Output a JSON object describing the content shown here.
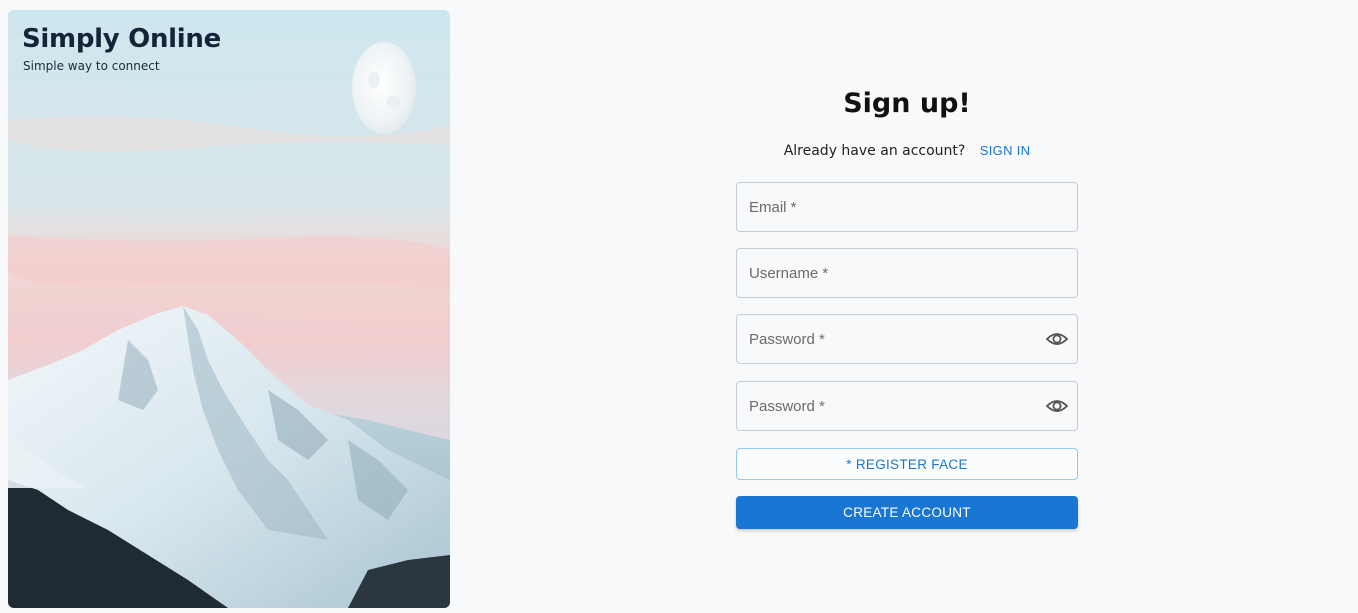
{
  "brand": {
    "title": "Simply Online",
    "tagline": "Simple way to connect"
  },
  "form": {
    "heading": "Sign up!",
    "signin_prompt": "Already have an account?",
    "signin_link": "SIGN IN",
    "fields": {
      "email": {
        "placeholder": "Email *",
        "value": ""
      },
      "username": {
        "placeholder": "Username *",
        "value": ""
      },
      "password": {
        "placeholder": "Password *",
        "value": ""
      },
      "password_confirm": {
        "placeholder": "Password *",
        "value": ""
      }
    },
    "register_face_label": "* REGISTER FACE",
    "create_account_label": "CREATE ACCOUNT"
  },
  "icons": {
    "visibility_toggle": "eye-icon"
  },
  "colors": {
    "accent": "#1976d2",
    "page_background": "#f7f9fb",
    "brand_text": "#16243a"
  }
}
